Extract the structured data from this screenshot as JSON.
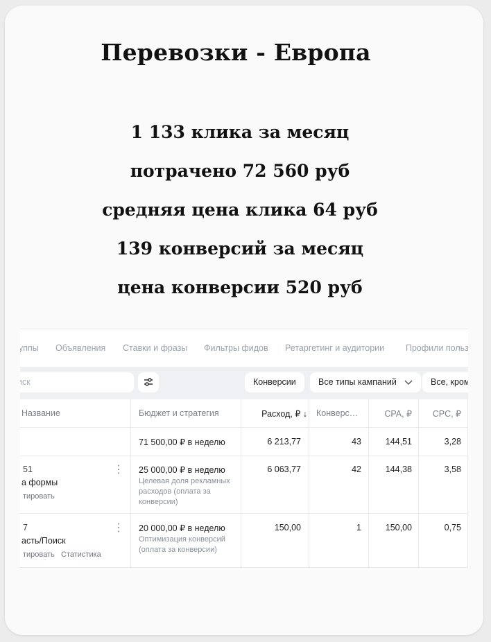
{
  "card": {
    "title": "Перевозки - Европа",
    "stats": [
      "1 133 клика за месяц",
      "потрачено 72 560 руб",
      "средняя цена клика 64 руб",
      "139 конверсий за месяц",
      "цена конверсии 520 руб"
    ]
  },
  "screenshot": {
    "tabs": [
      "уппы",
      "Объявления",
      "Ставки и фразы",
      "Фильтры фидов",
      "Ретаргетинг и аудитории",
      "Профили польз"
    ],
    "filters": {
      "search_placeholder": "иск",
      "settings_icon": "sliders-icon",
      "chip_conversions": "Конверсии",
      "chip_campaign_types": "Все типы кампаний",
      "chip_except": "Все, кроме"
    },
    "columns": {
      "name": "Название",
      "budget": "Бюджет и стратегия",
      "spend": "Расход, ₽ ↓",
      "conversions": "Конверс…",
      "cpa": "CPA, ₽",
      "cpc": "CPC, ₽"
    },
    "total_row": {
      "budget": "71 500,00 ₽ в неделю",
      "spend": "6 213,77",
      "conversions": "43",
      "cpa": "144,51",
      "cpc": "3,28"
    },
    "rows": [
      {
        "id": "51",
        "name": "а формы",
        "actions": "тировать",
        "budget": "25 000,00 ₽ в неделю",
        "strategy": "Целевая доля рекламных расходов (оплата за конверсии)",
        "spend": "6 063,77",
        "conversions": "42",
        "cpa": "144,38",
        "cpc": "3,58"
      },
      {
        "id": "7",
        "name": "асть/Поиск",
        "actions": "тировать",
        "stats_link": "Статистика",
        "budget": "20 000,00 ₽ в неделю",
        "strategy": "Оптимизация конверсий (оплата за конверсии)",
        "spend": "150,00",
        "conversions": "1",
        "cpa": "150,00",
        "cpc": "0,75"
      }
    ]
  }
}
